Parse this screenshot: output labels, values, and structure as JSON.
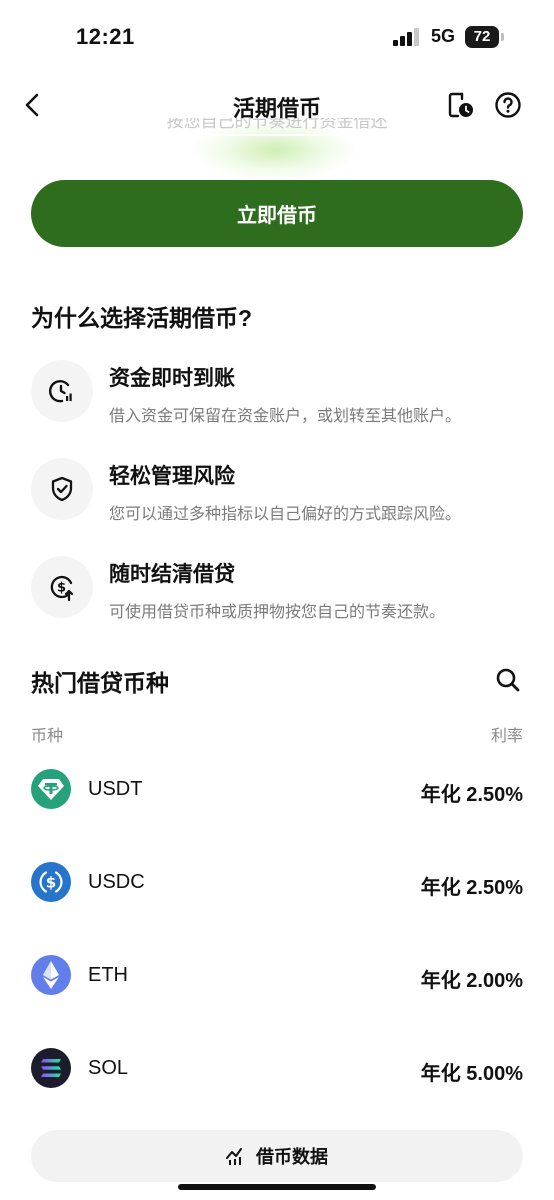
{
  "status_bar": {
    "time": "12:21",
    "network": "5G",
    "battery": "72"
  },
  "nav": {
    "title": "活期借币",
    "back_icon": "chevron-left-icon",
    "history_icon": "history-icon",
    "help_icon": "help-icon"
  },
  "hero": {
    "faded_text": "按您自己的节奏进行资金借还"
  },
  "primary_button": {
    "label": "立即借币"
  },
  "why_section": {
    "title": "为什么选择活期借币?",
    "features": [
      {
        "icon": "clock-chart-icon",
        "title": "资金即时到账",
        "description": "借入资金可保留在资金账户，或划转至其他账户。"
      },
      {
        "icon": "shield-check-icon",
        "title": "轻松管理风险",
        "description": "您可以通过多种指标以自己偏好的方式跟踪风险。"
      },
      {
        "icon": "dollar-refresh-icon",
        "title": "随时结清借贷",
        "description": "可使用借贷币种或质押物按您自己的节奏还款。"
      }
    ]
  },
  "popular_section": {
    "title": "热门借贷币种",
    "search_icon": "search-icon",
    "columns": {
      "coin": "币种",
      "rate": "利率"
    },
    "coins": [
      {
        "name": "USDT",
        "rate": "年化 2.50%",
        "logo_color": "#26a17b"
      },
      {
        "name": "USDC",
        "rate": "年化 2.50%",
        "logo_color": "#2775ca"
      },
      {
        "name": "ETH",
        "rate": "年化 2.00%",
        "logo_color": "#627eea"
      },
      {
        "name": "SOL",
        "rate": "年化 5.00%",
        "logo_color": "#1c1c2c"
      }
    ]
  },
  "bottom_button": {
    "label": "借币数据",
    "icon": "chart-icon"
  },
  "colors": {
    "primary": "#2e6d1d",
    "muted_text": "#7b7b7b"
  }
}
